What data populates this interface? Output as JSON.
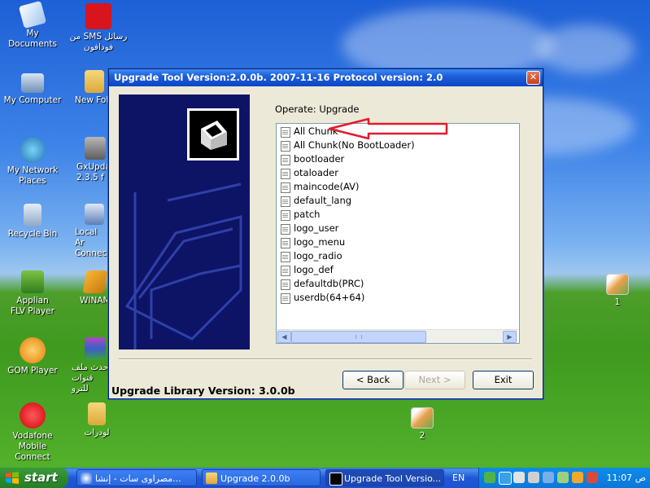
{
  "desktop": {
    "icons": [
      {
        "label": "My Documents"
      },
      {
        "label": "من SMS رسائل فودافون"
      },
      {
        "label": "My Computer"
      },
      {
        "label": "New Fol"
      },
      {
        "label": "My Network Places"
      },
      {
        "label": "GxUpda 2.3.5 f"
      },
      {
        "label": "Recycle Bin"
      },
      {
        "label": "Local Ar Connecti"
      },
      {
        "label": "Applian FLV Player"
      },
      {
        "label": "WINAM"
      },
      {
        "label": "GOM Player"
      },
      {
        "label": "حدث ملف قنوات للترو"
      },
      {
        "label": "Vodafone Mobile Connect"
      },
      {
        "label": "لودرات"
      },
      {
        "label": "1"
      },
      {
        "label": "2"
      }
    ]
  },
  "window": {
    "title": "Upgrade Tool Version:2.0.0b. 2007-11-16 Protocol version: 2.0",
    "close_label": "✕",
    "operate_label": "Operate: Upgrade",
    "items": [
      "All Chunk",
      "All Chunk(No BootLoader)",
      "bootloader",
      "otaloader",
      "maincode(AV)",
      "default_lang",
      "patch",
      "logo_user",
      "logo_menu",
      "logo_radio",
      "logo_def",
      "defaultdb(PRC)",
      "userdb(64+64)"
    ],
    "back_label": "< Back",
    "next_label": "Next >",
    "exit_label": "Exit",
    "library_label": "Upgrade Library Version: 3.0.0b"
  },
  "taskbar": {
    "start_label": "start",
    "tasks": [
      {
        "label": "مصراوى سات - إنشا..."
      },
      {
        "label": "Upgrade 2.0.0b"
      },
      {
        "label": "Upgrade Tool Versio..."
      }
    ],
    "language": "EN",
    "clock": "11:07 ص"
  },
  "colors": {
    "title_bar": "#0a46c6",
    "banner": "#0d1466",
    "annotation_arrow": "#e21b2d"
  }
}
